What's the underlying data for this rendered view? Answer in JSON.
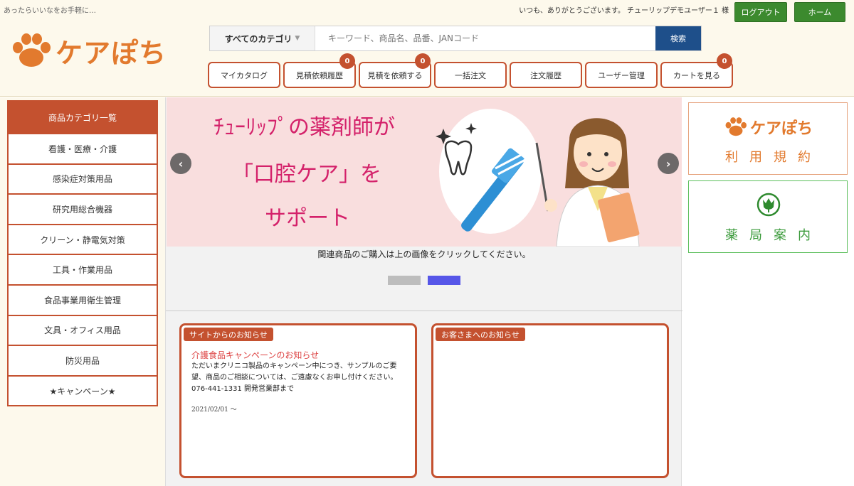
{
  "header": {
    "tagline": "あったらいいなをお手軽に…",
    "greeting": "いつも、ありがとうございます。 チューリップデモユーザー１ 様",
    "logout_label": "ログアウト",
    "home_label": "ホーム",
    "logo_text": "ケアぽち"
  },
  "search": {
    "category_label": "すべてのカテゴリ",
    "placeholder": "キーワード、商品名、品番、JANコード",
    "button_label": "検索"
  },
  "nav": {
    "items": [
      {
        "label": "マイカタログ",
        "badge": ""
      },
      {
        "label": "見積依頼履歴",
        "badge": "0"
      },
      {
        "label": "見積を依頼する",
        "badge": "0"
      },
      {
        "label": "一括注文",
        "badge": ""
      },
      {
        "label": "注文履歴",
        "badge": ""
      },
      {
        "label": "ユーザー管理",
        "badge": ""
      },
      {
        "label": "カートを見る",
        "badge": "0"
      }
    ]
  },
  "sidebar": {
    "title": "商品カテゴリ一覧",
    "items": [
      {
        "label": "看護・医療・介護"
      },
      {
        "label": "感染症対策用品"
      },
      {
        "label": "研究用総合機器"
      },
      {
        "label": "クリーン・静電気対策"
      },
      {
        "label": "工具・作業用品"
      },
      {
        "label": "食品事業用衛生管理"
      },
      {
        "label": "文具・オフィス用品"
      },
      {
        "label": "防災用品"
      },
      {
        "label": "★キャンペーン★"
      }
    ]
  },
  "banner": {
    "line1": "ﾁｭｰﾘｯﾌﾟの薬剤師が",
    "line2": "「口腔ケア」を",
    "line3": "サポート",
    "caption": "関連商品のご購入は上の画像をクリックしてください。",
    "prev_label": "‹",
    "next_label": "›"
  },
  "notices": {
    "site": {
      "tag": "サイトからのお知らせ",
      "title": "介護食品キャンペーンのお知らせ",
      "body": "ただいまクリニコ製品のキャンペーン中につき、サンプルのご要望、商品のご相談については、ご遠慮なくお申し付けください。076-441-1331 開発営業部まで",
      "date": "2021/02/01 ～"
    },
    "customer": {
      "tag": "お客さまへのお知らせ"
    }
  },
  "right": {
    "terms_logo": "ケアぽち",
    "terms_label": "利用規約",
    "pharmacy_label": "薬局案内"
  },
  "colors": {
    "accent": "#c4512f",
    "logo_orange": "#e27a2e",
    "green_button": "#3c8a2e",
    "search_button": "#1e4f8a",
    "banner_pink": "#f9dede",
    "banner_text": "#d4216a"
  }
}
